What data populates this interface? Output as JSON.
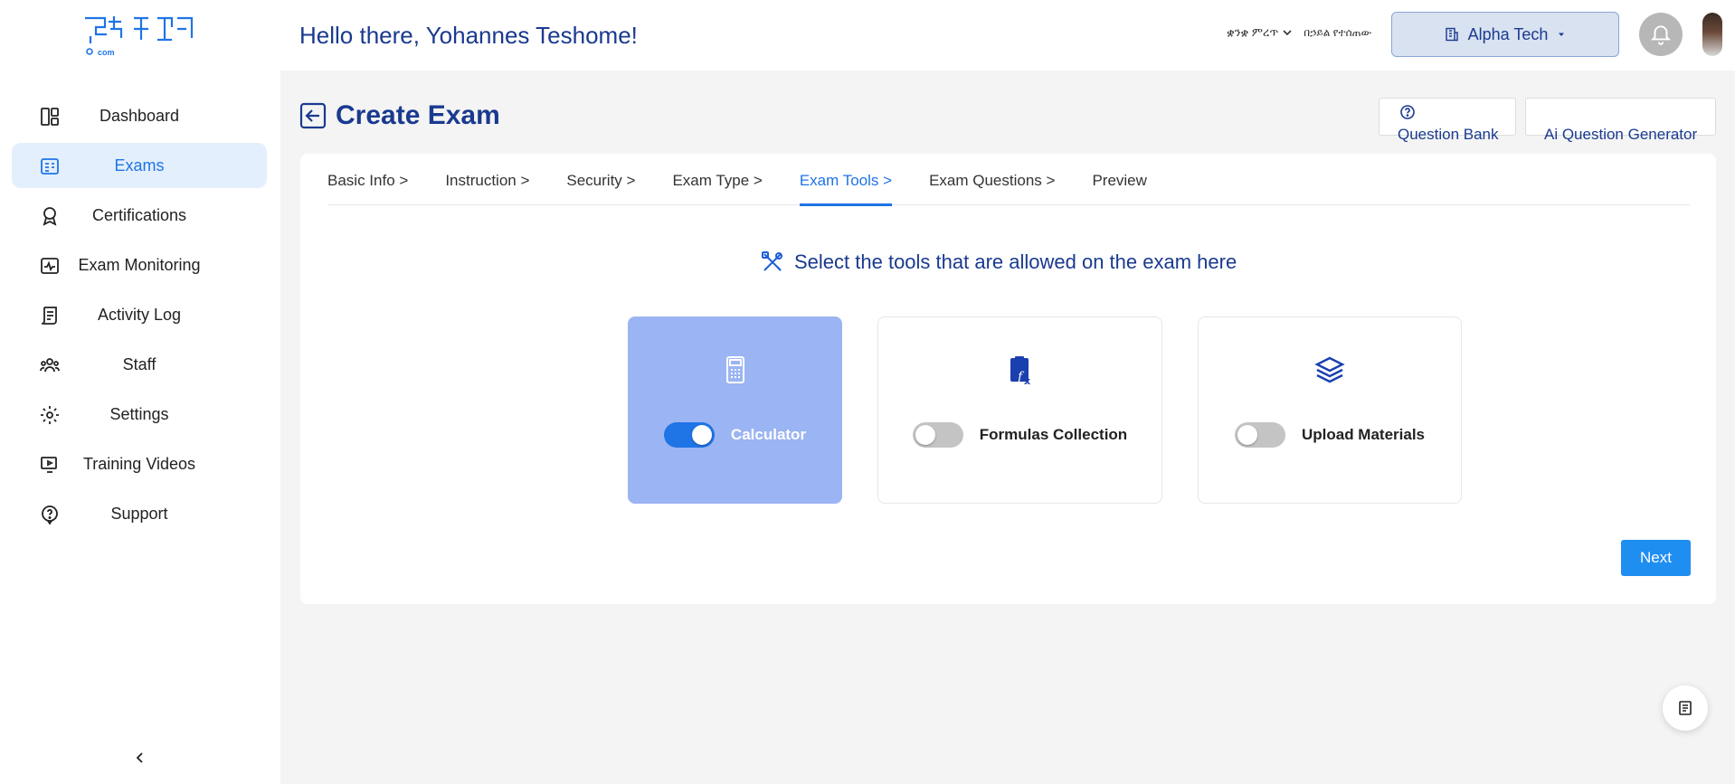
{
  "sidebar": {
    "logo_icon": "brand-logo-icon",
    "items": [
      {
        "label": "Dashboard",
        "icon": "dashboard-icon"
      },
      {
        "label": "Exams",
        "icon": "exams-icon",
        "active": true
      },
      {
        "label": "Certifications",
        "icon": "certificate-icon"
      },
      {
        "label": "Exam Monitoring",
        "icon": "monitoring-icon"
      },
      {
        "label": "Activity Log",
        "icon": "activity-log-icon"
      },
      {
        "label": "Staff",
        "icon": "staff-icon"
      },
      {
        "label": "Settings",
        "icon": "gear-icon"
      },
      {
        "label": "Training Videos",
        "icon": "video-icon"
      },
      {
        "label": "Support",
        "icon": "help-icon"
      }
    ],
    "collapse_icon": "chevron-left-icon"
  },
  "header": {
    "greeting": "Hello there, Yohannes Teshome!",
    "language": "ቋንቋ ምረጥ",
    "language_secondary": "በኃይል የተሰጠው",
    "organization": "Alpha Tech",
    "bell_icon": "bell-icon"
  },
  "page": {
    "title": "Create Exam",
    "question_bank": "Question Bank",
    "ai_generator": "Ai Question Generator"
  },
  "tabs": [
    {
      "label": "Basic Info >"
    },
    {
      "label": "Instruction >"
    },
    {
      "label": "Security >"
    },
    {
      "label": "Exam Type >"
    },
    {
      "label": "Exam Tools >",
      "active": true
    },
    {
      "label": "Exam Questions >"
    },
    {
      "label": "Preview"
    }
  ],
  "tools_section": {
    "heading": "Select the tools that are allowed on the exam here",
    "tools": [
      {
        "label": "Calculator",
        "enabled": true,
        "icon": "calculator-icon"
      },
      {
        "label": "Formulas Collection",
        "enabled": false,
        "icon": "formula-icon"
      },
      {
        "label": "Upload Materials",
        "enabled": false,
        "icon": "layers-icon"
      }
    ]
  },
  "next_label": "Next",
  "colors": {
    "primary": "#1f74e6",
    "title": "#1a3a8f",
    "active_tool_bg": "#9bb4f3"
  }
}
